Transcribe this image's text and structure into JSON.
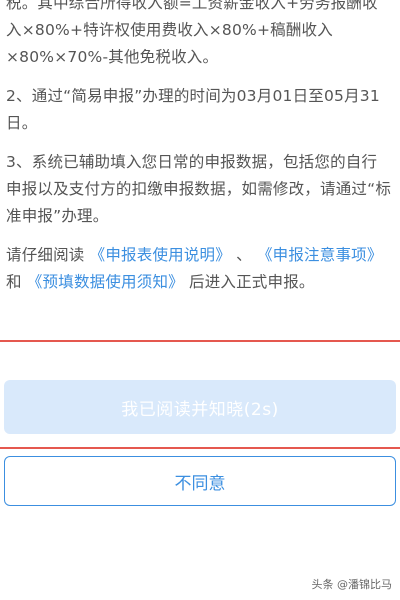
{
  "notice": {
    "paragraph1_cont": "税。其中综合所得收入额=工资薪金收入+劳务报酬收入×80%+特许权使用费收入×80%+稿酬收入×80%×70%-其他免税收入。",
    "paragraph2": "2、通过“简易申报”办理的时间为03月01日至05月31日。",
    "paragraph3": "3、系统已辅助填入您日常的申报数据，包括您的自行申报以及支付方的扣缴申报数据，如需修改，请通过“标准申报”办理。",
    "read_prefix": "请仔细阅读",
    "link1": "《申报表使用说明》",
    "sep1": "、",
    "link2": "《申报注意事项》",
    "sep2": "和",
    "link3": "《预填数据使用须知》",
    "read_suffix": "后进入正式申报。"
  },
  "buttons": {
    "agree_label": "我已阅读并知晓(2s)",
    "disagree_label": "不同意"
  },
  "watermark": "头条 @潘锦比马",
  "colors": {
    "link": "#3c8fe0",
    "highlight_line": "#e5584f",
    "agree_disabled_bg": "#d9e9fb"
  }
}
